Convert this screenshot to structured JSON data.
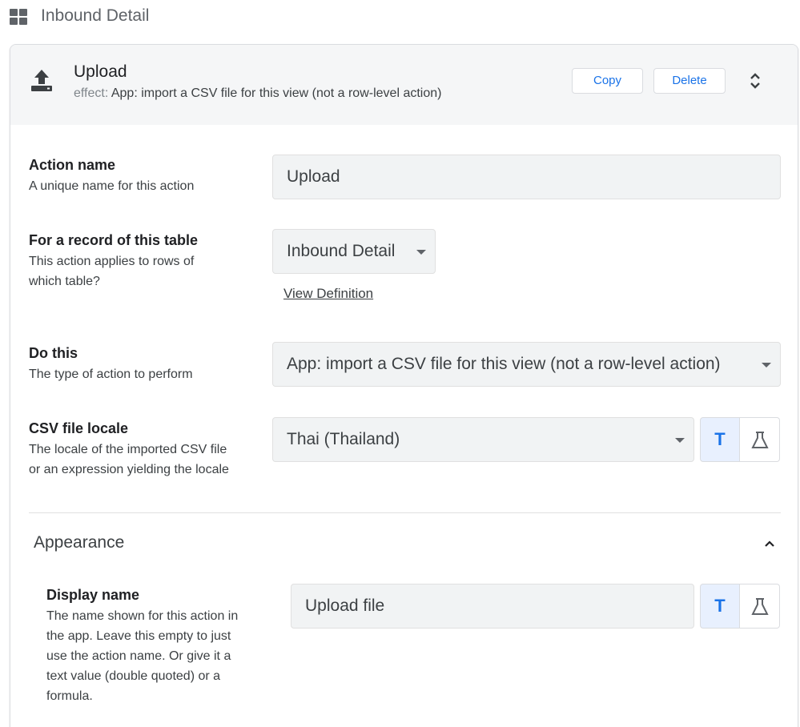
{
  "topbar": {
    "title": "Inbound Detail",
    "icon": "grid-view-icon"
  },
  "action": {
    "title": "Upload",
    "effect_label": "effect:",
    "effect_text": "App: import a CSV file for this view (not a row-level action)",
    "icon": "upload-icon"
  },
  "buttons": {
    "copy": "Copy",
    "delete": "Delete"
  },
  "fields": {
    "action_name": {
      "title": "Action name",
      "desc": "A unique name for this action",
      "value": "Upload"
    },
    "table": {
      "title": "For a record of this table",
      "desc_lines": [
        "This action applies to rows of",
        "which table?"
      ],
      "value": "Inbound Detail",
      "link": "View Definition"
    },
    "do_this": {
      "title": "Do this",
      "desc": "The type of action to perform",
      "value": "App: import a CSV file for this view (not a row-level action)"
    },
    "csv_locale": {
      "title": "CSV file locale",
      "desc_lines": [
        "The locale of the imported CSV file",
        "or an expression yielding the locale"
      ],
      "value": "Thai (Thailand)"
    }
  },
  "appearance": {
    "title": "Appearance",
    "display_name": {
      "title": "Display name",
      "desc_lines": [
        "The name shown for this action in",
        "the app. Leave this empty to just",
        "use the action name. Or give it a",
        "text value (double quoted) or a",
        "formula."
      ],
      "value": "Upload file"
    }
  },
  "toggle": {
    "text_mode": "T"
  },
  "colors": {
    "accent": "#1a73e8",
    "header_bg": "#f5f6f7",
    "input_bg": "#f1f3f4",
    "toggle_active_bg": "#e8f0fe"
  }
}
